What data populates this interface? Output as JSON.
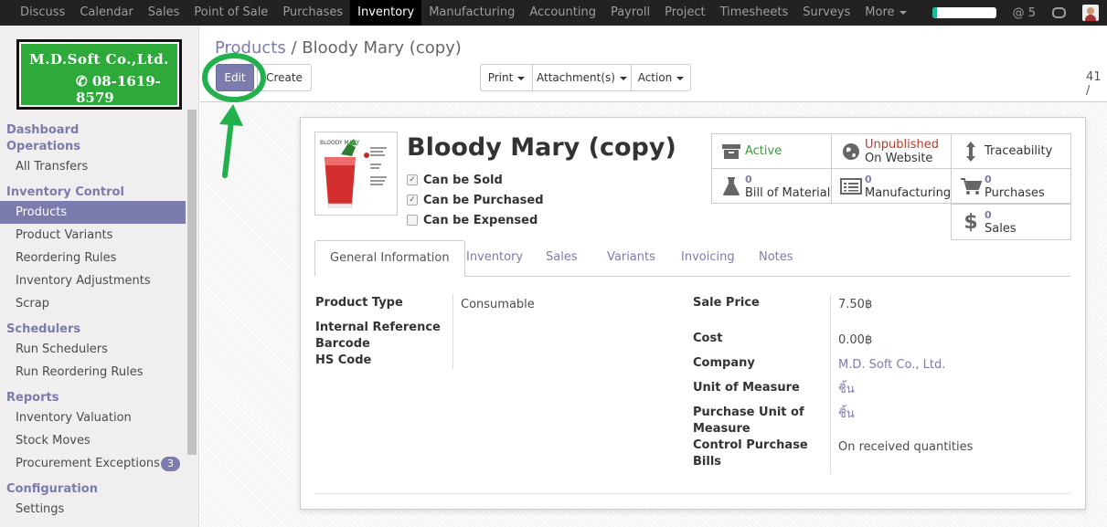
{
  "topbar": {
    "menu": [
      "Discuss",
      "Calendar",
      "Sales",
      "Point of Sale",
      "Purchases",
      "Inventory",
      "Manufacturing",
      "Accounting",
      "Payroll",
      "Project",
      "Timesheets",
      "Surveys"
    ],
    "more_label": "More",
    "active_index": 5,
    "activity_progress": 0.08,
    "mentions_count": "5",
    "accent": "#1abc9c"
  },
  "logo": {
    "company": "M.D.Soft Co.,Ltd.",
    "phone": "08-1619-8579"
  },
  "sidebar": {
    "sections": [
      {
        "title": "Dashboard",
        "items": []
      },
      {
        "title": "Operations",
        "items": [
          {
            "label": "All Transfers"
          }
        ]
      },
      {
        "title": "Inventory Control",
        "items": [
          {
            "label": "Products",
            "active": true
          },
          {
            "label": "Product Variants"
          },
          {
            "label": "Reordering Rules"
          },
          {
            "label": "Inventory Adjustments"
          },
          {
            "label": "Scrap"
          }
        ]
      },
      {
        "title": "Schedulers",
        "items": [
          {
            "label": "Run Schedulers"
          },
          {
            "label": "Run Reordering Rules"
          }
        ]
      },
      {
        "title": "Reports",
        "items": [
          {
            "label": "Inventory Valuation"
          },
          {
            "label": "Stock Moves"
          },
          {
            "label": "Procurement Exceptions",
            "badge": "3"
          }
        ]
      },
      {
        "title": "Configuration",
        "items": [
          {
            "label": "Settings"
          }
        ]
      }
    ]
  },
  "breadcrumb": {
    "parent": "Products",
    "separator": "/",
    "current": "Bloody Mary (copy)"
  },
  "buttons": {
    "edit": "Edit",
    "create": "Create",
    "print": "Print",
    "attachments": "Attachment(s)",
    "action": "Action"
  },
  "pager": "41 /",
  "product": {
    "name": "Bloody Mary (copy)",
    "image_caption": "BLOODY MARY",
    "checks": [
      {
        "label": "Can be Sold",
        "checked": true
      },
      {
        "label": "Can be Purchased",
        "checked": true
      },
      {
        "label": "Can be Expensed",
        "checked": false
      }
    ]
  },
  "smart_buttons": {
    "active": "Active",
    "unpublished": "Unpublished",
    "on_website": "On Website",
    "traceability": "Traceability",
    "bom_count": "0",
    "bom_label": "Bill of Materials",
    "mfg_count": "0",
    "mfg_label": "Manufacturing",
    "purchases_count": "0",
    "purchases_label": "Purchases",
    "sales_count": "0",
    "sales_label": "Sales"
  },
  "tabs": [
    "General Information",
    "Inventory",
    "Sales",
    "Variants",
    "Invoicing",
    "Notes"
  ],
  "general": {
    "product_type_label": "Product Type",
    "product_type": "Consumable",
    "internal_ref_label": "Internal Reference",
    "barcode_label": "Barcode",
    "hs_code_label": "HS Code",
    "sale_price_label": "Sale Price",
    "sale_price": "7.50฿",
    "cost_label": "Cost",
    "cost": "0.00฿",
    "company_label": "Company",
    "company": "M.D. Soft Co., Ltd.",
    "uom_label": "Unit of Measure",
    "uom": "ชิ้น",
    "purchase_uom_label": "Purchase Unit of Measure",
    "purchase_uom": "ชิ้น",
    "control_label": "Control Purchase Bills",
    "control": "On received quantities"
  }
}
